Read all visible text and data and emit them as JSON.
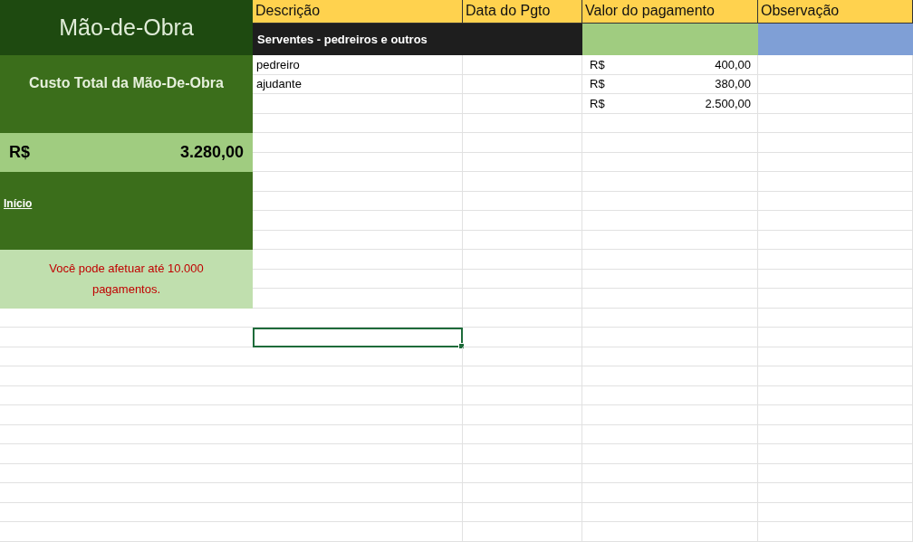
{
  "panel": {
    "title": "Mão-de-Obra",
    "total_label": "Custo Total da Mão-De-Obra",
    "total_currency": "R$",
    "total_value": "3.280,00",
    "link": "Início",
    "note": "Você pode afetuar até 10.000 pagamentos."
  },
  "columns": [
    "Descrição",
    "Data do Pgto",
    "Valor do pagamento",
    "Observação"
  ],
  "group_row": {
    "label": "Serventes - pedreiros e outros"
  },
  "rows": [
    {
      "description": "pedreiro",
      "currency": "R$",
      "amount": "400,00",
      "selected": false
    },
    {
      "description": "ajudante",
      "currency": "R$",
      "amount": "380,00",
      "selected": false
    },
    {
      "currency": "R$",
      "amount": "2.500,00",
      "selected": false
    },
    {
      "selected": false
    },
    {
      "selected": false
    },
    {
      "selected": false
    },
    {
      "selected": false
    },
    {
      "selected": false
    },
    {
      "selected": false
    },
    {
      "selected": false
    },
    {
      "selected": false
    },
    {
      "selected": false
    },
    {
      "selected": false
    },
    {
      "selected": false
    },
    {
      "selected": true
    },
    {
      "selected": false
    },
    {
      "selected": false
    },
    {
      "selected": false
    },
    {
      "selected": false
    },
    {
      "selected": false
    },
    {
      "selected": false
    },
    {
      "selected": false
    },
    {
      "selected": false
    },
    {
      "selected": false
    },
    {
      "selected": false
    }
  ]
}
